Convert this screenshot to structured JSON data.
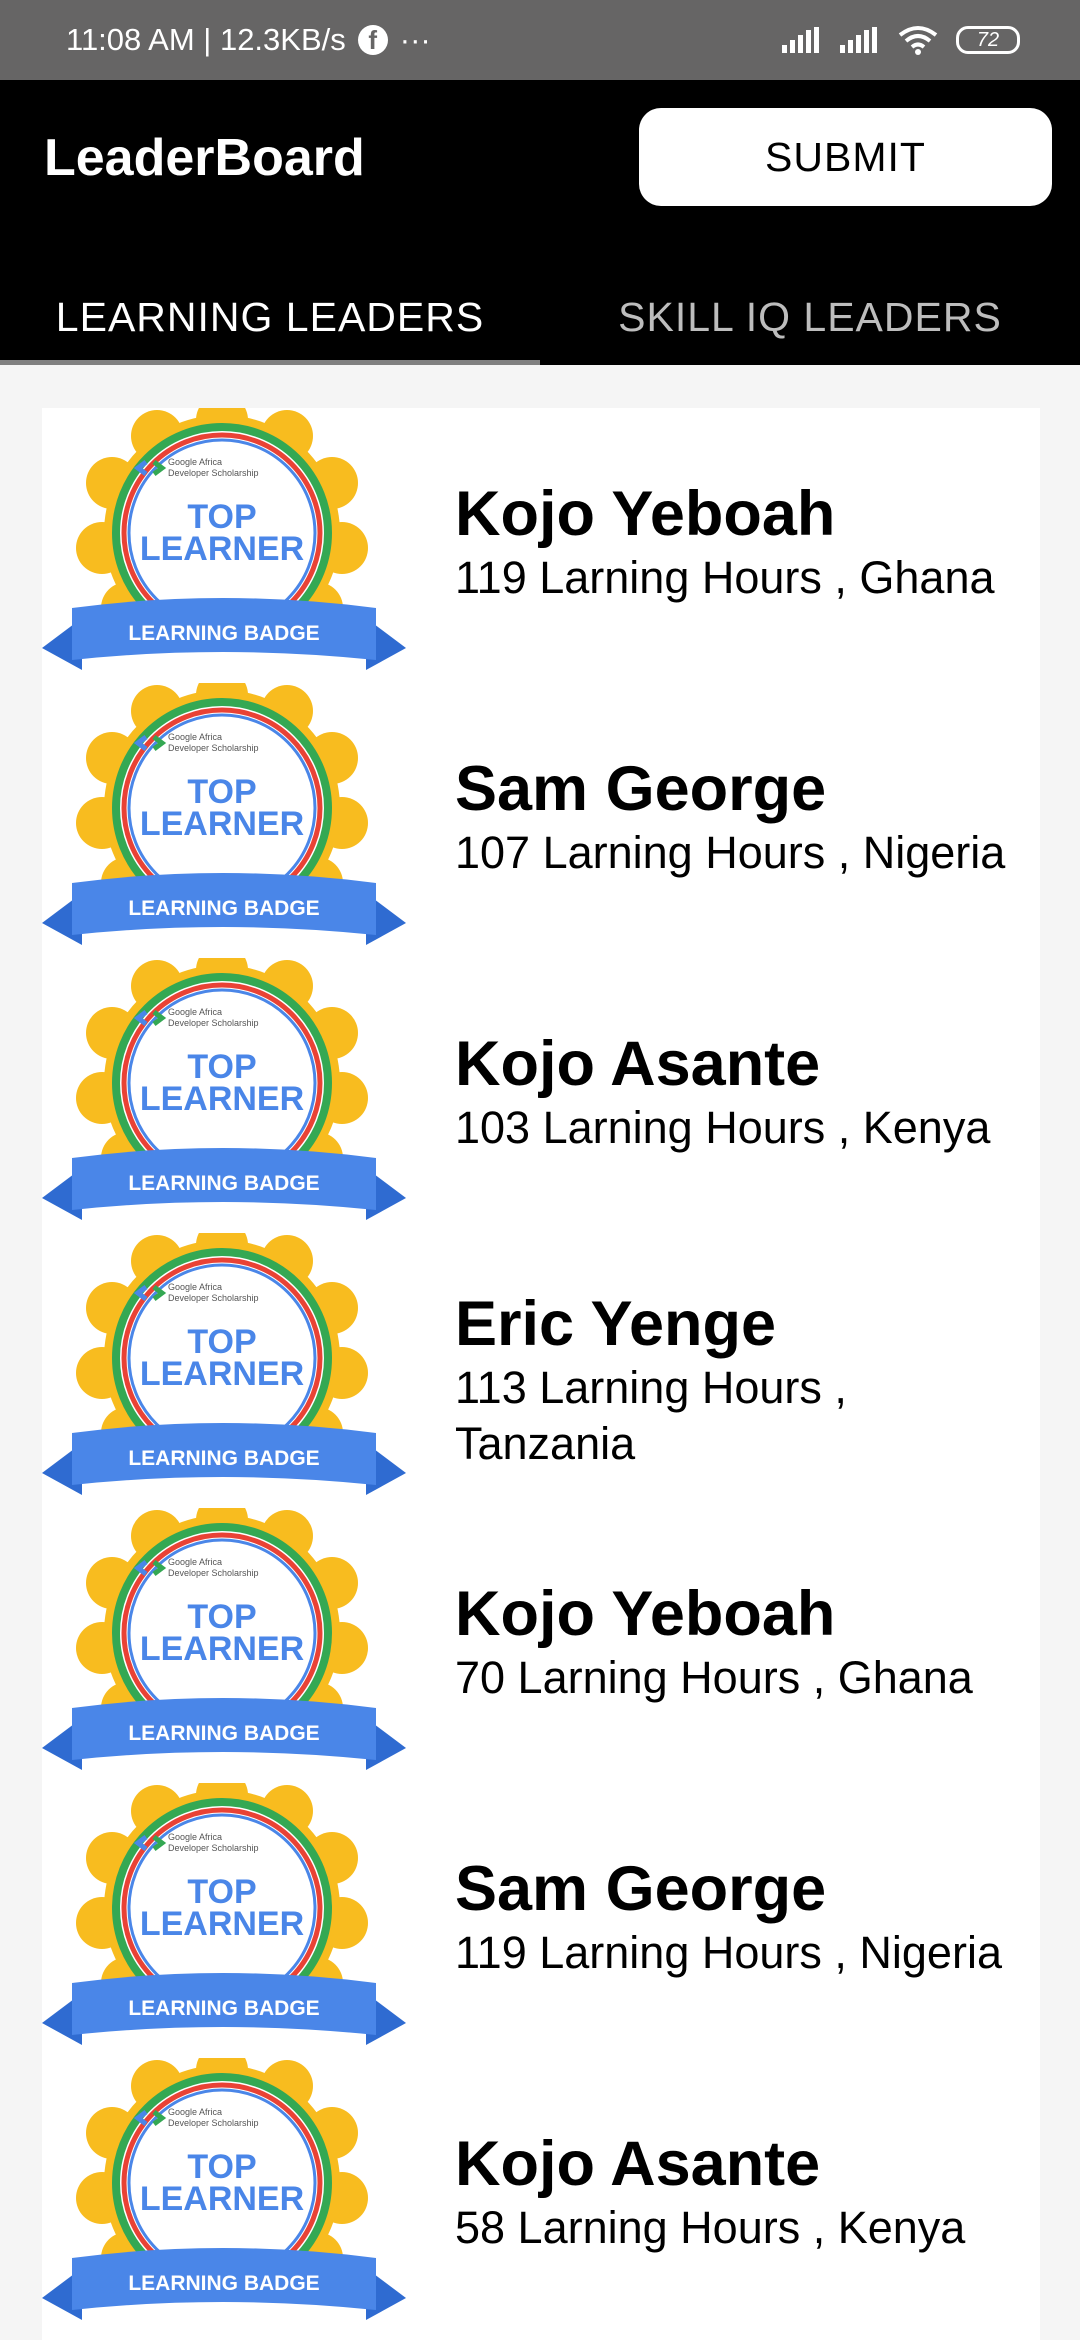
{
  "status_bar": {
    "time": "11:08 AM | 12.3KB/s",
    "dots": "···",
    "battery": "72"
  },
  "app_bar": {
    "title": "LeaderBoard",
    "submit_label": "SUBMIT",
    "tabs": [
      {
        "label": "LEARNING LEADERS"
      },
      {
        "label": "SKILL IQ LEADERS"
      }
    ]
  },
  "badge": {
    "brand": "Google Africa",
    "brand_sub": "Developer Scholarship",
    "line1": "TOP",
    "line2": "LEARNER",
    "ribbon": "LEARNING BADGE"
  },
  "leaders": [
    {
      "name": "Kojo Yeboah",
      "detail": "119 Larning Hours , Ghana"
    },
    {
      "name": "Sam George",
      "detail": "107 Larning Hours , Nigeria"
    },
    {
      "name": "Kojo Asante",
      "detail": "103 Larning Hours , Kenya"
    },
    {
      "name": "Eric Yenge",
      "detail": "113 Larning Hours , Tanzania"
    },
    {
      "name": "Kojo Yeboah",
      "detail": "70 Larning Hours , Ghana"
    },
    {
      "name": "Sam George",
      "detail": "119 Larning Hours , Nigeria"
    },
    {
      "name": "Kojo Asante",
      "detail": "58 Larning Hours , Kenya"
    }
  ],
  "colors": {
    "badge_gold": "#f8bc1f",
    "badge_blue": "#4a86e8",
    "badge_ribbon_dark": "#2f6bd1",
    "badge_red": "#e94235",
    "badge_green": "#34a853"
  }
}
